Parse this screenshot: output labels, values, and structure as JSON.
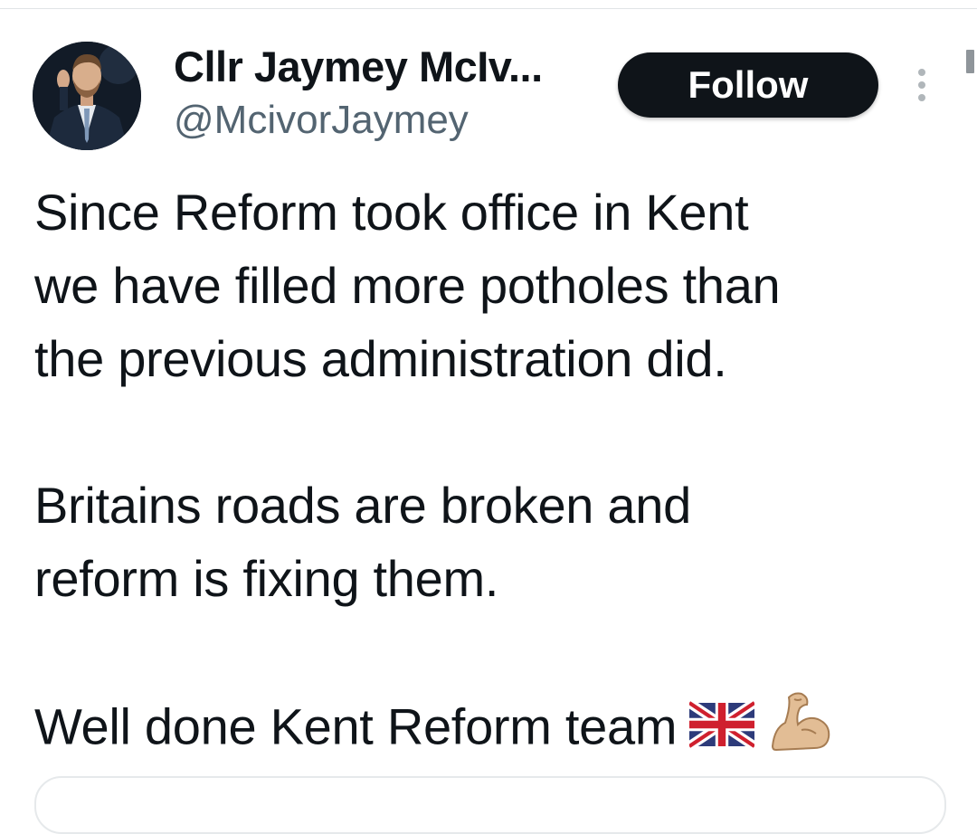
{
  "author": {
    "display_name": "Cllr Jaymey McIv...",
    "handle": "@McivorJaymey"
  },
  "actions": {
    "follow_label": "Follow"
  },
  "tweet": {
    "lines": [
      "Since Reform took office in Kent",
      "we have filled more potholes than",
      "the previous administration did.",
      "",
      "Britains roads are broken and",
      "reform is fixing them.",
      "",
      "Well done Kent Reform team"
    ],
    "emojis": [
      "union-jack-flag",
      "flexed-biceps"
    ]
  },
  "colors": {
    "text": "#0f1419",
    "secondary_text": "#536471",
    "follow_bg": "#0f1419",
    "follow_text": "#ffffff"
  }
}
